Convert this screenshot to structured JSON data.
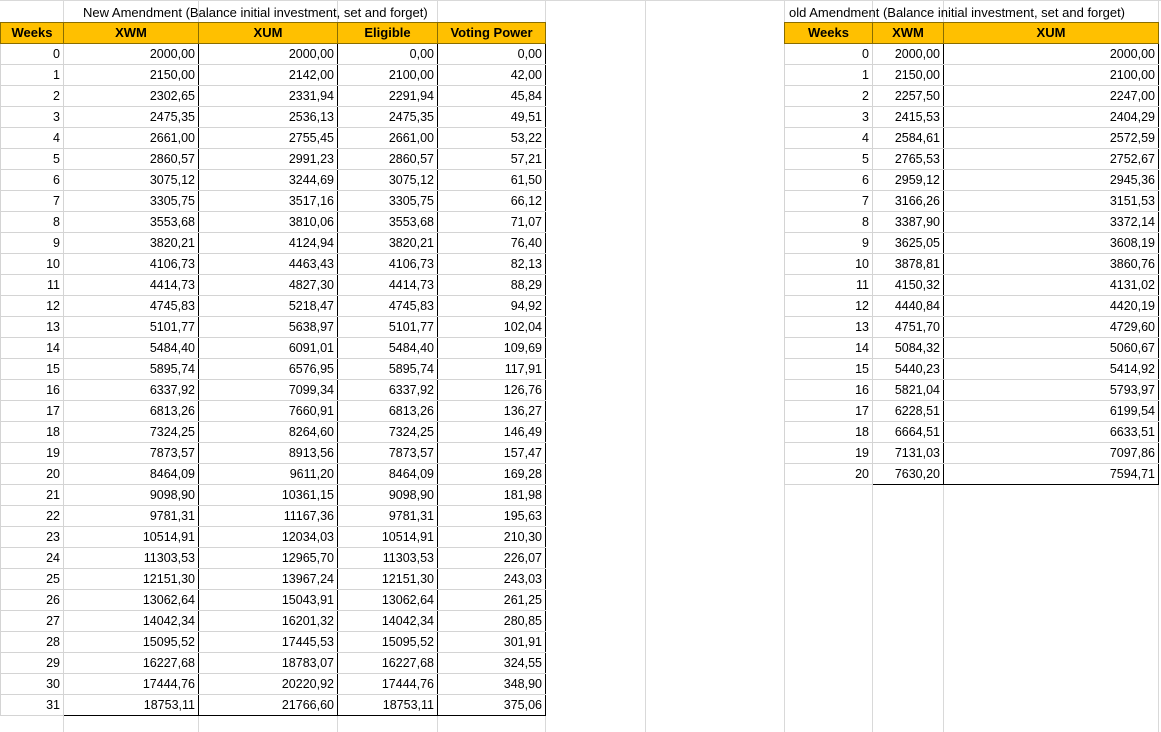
{
  "new_table": {
    "title": "New Amendment (Balance initial investment, set and forget)",
    "headers": [
      "Weeks",
      "XWM",
      "XUM",
      "Eligible",
      "Voting Power"
    ],
    "rows": [
      [
        "0",
        "2000,00",
        "2000,00",
        "0,00",
        "0,00"
      ],
      [
        "1",
        "2150,00",
        "2142,00",
        "2100,00",
        "42,00"
      ],
      [
        "2",
        "2302,65",
        "2331,94",
        "2291,94",
        "45,84"
      ],
      [
        "3",
        "2475,35",
        "2536,13",
        "2475,35",
        "49,51"
      ],
      [
        "4",
        "2661,00",
        "2755,45",
        "2661,00",
        "53,22"
      ],
      [
        "5",
        "2860,57",
        "2991,23",
        "2860,57",
        "57,21"
      ],
      [
        "6",
        "3075,12",
        "3244,69",
        "3075,12",
        "61,50"
      ],
      [
        "7",
        "3305,75",
        "3517,16",
        "3305,75",
        "66,12"
      ],
      [
        "8",
        "3553,68",
        "3810,06",
        "3553,68",
        "71,07"
      ],
      [
        "9",
        "3820,21",
        "4124,94",
        "3820,21",
        "76,40"
      ],
      [
        "10",
        "4106,73",
        "4463,43",
        "4106,73",
        "82,13"
      ],
      [
        "11",
        "4414,73",
        "4827,30",
        "4414,73",
        "88,29"
      ],
      [
        "12",
        "4745,83",
        "5218,47",
        "4745,83",
        "94,92"
      ],
      [
        "13",
        "5101,77",
        "5638,97",
        "5101,77",
        "102,04"
      ],
      [
        "14",
        "5484,40",
        "6091,01",
        "5484,40",
        "109,69"
      ],
      [
        "15",
        "5895,74",
        "6576,95",
        "5895,74",
        "117,91"
      ],
      [
        "16",
        "6337,92",
        "7099,34",
        "6337,92",
        "126,76"
      ],
      [
        "17",
        "6813,26",
        "7660,91",
        "6813,26",
        "136,27"
      ],
      [
        "18",
        "7324,25",
        "8264,60",
        "7324,25",
        "146,49"
      ],
      [
        "19",
        "7873,57",
        "8913,56",
        "7873,57",
        "157,47"
      ],
      [
        "20",
        "8464,09",
        "9611,20",
        "8464,09",
        "169,28"
      ],
      [
        "21",
        "9098,90",
        "10361,15",
        "9098,90",
        "181,98"
      ],
      [
        "22",
        "9781,31",
        "11167,36",
        "9781,31",
        "195,63"
      ],
      [
        "23",
        "10514,91",
        "12034,03",
        "10514,91",
        "210,30"
      ],
      [
        "24",
        "11303,53",
        "12965,70",
        "11303,53",
        "226,07"
      ],
      [
        "25",
        "12151,30",
        "13967,24",
        "12151,30",
        "243,03"
      ],
      [
        "26",
        "13062,64",
        "15043,91",
        "13062,64",
        "261,25"
      ],
      [
        "27",
        "14042,34",
        "16201,32",
        "14042,34",
        "280,85"
      ],
      [
        "28",
        "15095,52",
        "17445,53",
        "15095,52",
        "301,91"
      ],
      [
        "29",
        "16227,68",
        "18783,07",
        "16227,68",
        "324,55"
      ],
      [
        "30",
        "17444,76",
        "20220,92",
        "17444,76",
        "348,90"
      ],
      [
        "31",
        "18753,11",
        "21766,60",
        "18753,11",
        "375,06"
      ]
    ]
  },
  "old_table": {
    "title": "old Amendment (Balance initial investment, set and forget)",
    "headers": [
      "Weeks",
      "XWM",
      "XUM"
    ],
    "rows": [
      [
        "0",
        "2000,00",
        "2000,00"
      ],
      [
        "1",
        "2150,00",
        "2100,00"
      ],
      [
        "2",
        "2257,50",
        "2247,00"
      ],
      [
        "3",
        "2415,53",
        "2404,29"
      ],
      [
        "4",
        "2584,61",
        "2572,59"
      ],
      [
        "5",
        "2765,53",
        "2752,67"
      ],
      [
        "6",
        "2959,12",
        "2945,36"
      ],
      [
        "7",
        "3166,26",
        "3151,53"
      ],
      [
        "8",
        "3387,90",
        "3372,14"
      ],
      [
        "9",
        "3625,05",
        "3608,19"
      ],
      [
        "10",
        "3878,81",
        "3860,76"
      ],
      [
        "11",
        "4150,32",
        "4131,02"
      ],
      [
        "12",
        "4440,84",
        "4420,19"
      ],
      [
        "13",
        "4751,70",
        "4729,60"
      ],
      [
        "14",
        "5084,32",
        "5060,67"
      ],
      [
        "15",
        "5440,23",
        "5414,92"
      ],
      [
        "16",
        "5821,04",
        "5793,97"
      ],
      [
        "17",
        "6228,51",
        "6199,54"
      ],
      [
        "18",
        "6664,51",
        "6633,51"
      ],
      [
        "19",
        "7131,03",
        "7097,86"
      ],
      [
        "20",
        "7630,20",
        "7594,71"
      ]
    ]
  },
  "colors": {
    "header_fill": "#ffc000",
    "gridline": "#d9d9d9"
  }
}
